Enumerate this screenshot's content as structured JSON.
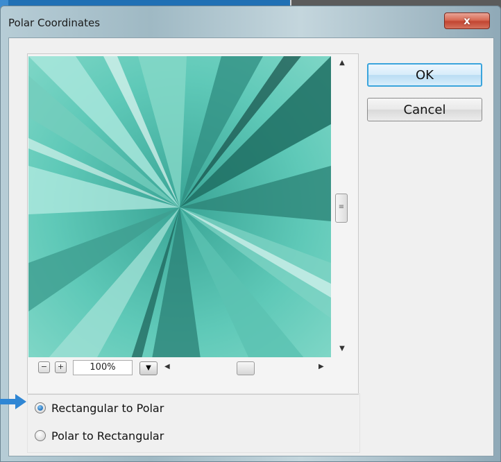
{
  "window": {
    "title": "Polar Coordinates",
    "close_glyph": "x"
  },
  "buttons": {
    "ok_label": "OK",
    "cancel_label": "Cancel"
  },
  "zoom": {
    "minus_glyph": "−",
    "plus_glyph": "+",
    "value": "100%"
  },
  "options": [
    {
      "label": "Rectangular to Polar",
      "checked": true
    },
    {
      "label": "Polar to Rectangular",
      "checked": false
    }
  ],
  "colors": {
    "accent_blue": "#3aa4dc",
    "preview_teal": "#48b9a8",
    "close_red": "#c24632"
  },
  "icons": {
    "close": "close-icon",
    "pointer": "arrow-right-icon"
  }
}
